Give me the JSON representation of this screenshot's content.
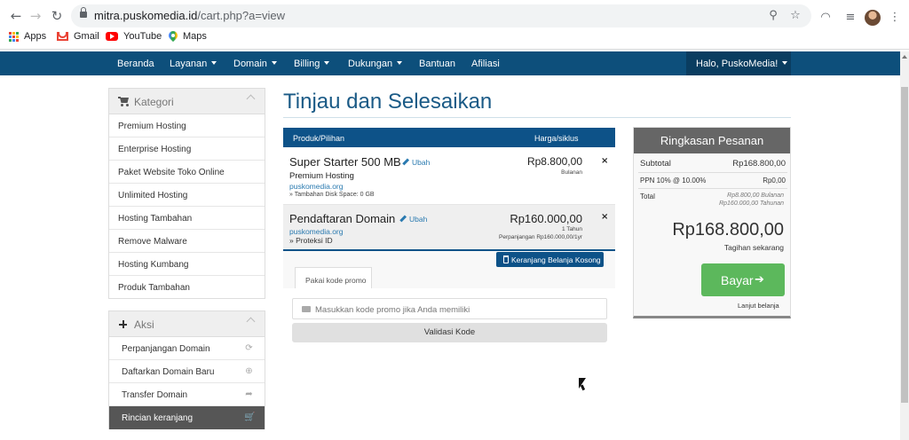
{
  "browser": {
    "url_host": "mitra.puskomedia.id",
    "url_path": "/cart.php?a=view",
    "back_icon": "arrow-left-icon",
    "forward_icon": "arrow-right-icon",
    "reload_icon": "reload-icon",
    "bookmarks": [
      {
        "label": "Apps",
        "icon": "apps-grid-icon"
      },
      {
        "label": "Gmail",
        "icon": "gmail-icon"
      },
      {
        "label": "YouTube",
        "icon": "youtube-icon"
      },
      {
        "label": "Maps",
        "icon": "maps-icon"
      }
    ]
  },
  "navbar": {
    "items": [
      {
        "label": "Beranda",
        "dropdown": false
      },
      {
        "label": "Layanan",
        "dropdown": true
      },
      {
        "label": "Domain",
        "dropdown": true
      },
      {
        "label": "Billing",
        "dropdown": true
      },
      {
        "label": "Dukungan",
        "dropdown": true
      },
      {
        "label": "Bantuan",
        "dropdown": false
      },
      {
        "label": "Afiliasi",
        "dropdown": false
      }
    ],
    "account_label": "Halo, PuskoMedia!",
    "color": "#0d4f7b"
  },
  "sidebar": {
    "kategori": {
      "title": "Kategori",
      "icon": "cart-icon",
      "items": [
        "Premium Hosting",
        "Enterprise Hosting",
        "Paket Website Toko Online",
        "Unlimited Hosting",
        "Hosting Tambahan",
        "Remove Malware",
        "Hosting Kumbang",
        "Produk Tambahan"
      ]
    },
    "aksi": {
      "title": "Aksi",
      "icon": "plus-icon",
      "items": [
        {
          "label": "Perpanjangan Domain",
          "icon": "refresh-icon"
        },
        {
          "label": "Daftarkan Domain Baru",
          "icon": "globe-icon"
        },
        {
          "label": "Transfer Domain",
          "icon": "share-icon"
        },
        {
          "label": "Rincian keranjang",
          "icon": "cart-icon",
          "active": true
        }
      ]
    }
  },
  "main": {
    "title": "Tinjau dan Selesaikan",
    "table_header": {
      "product": "Produk/Pilihan",
      "price": "Harga/siklus"
    },
    "items": [
      {
        "name": "Super Starter 500 MB",
        "edit": "Ubah",
        "group": "Premium Hosting",
        "domain": "puskomedia.org",
        "addon": "» Tambahan Disk Space: 0 GB",
        "price": "Rp8.800,00",
        "cycle": "Bulanan"
      },
      {
        "name": "Pendaftaran Domain",
        "edit": "Ubah",
        "domain": "puskomedia.org",
        "addon": "» Proteksi ID",
        "price": "Rp160.000,00",
        "cycle": "1 Tahun",
        "renewal": "Perpanjangan Rp160.000,00/1yr"
      }
    ],
    "remove_glyph": "×",
    "empty_cart_button": "Keranjang Belanja Kosong",
    "promo_tab": "Pakai kode promo",
    "promo_placeholder": "Masukkan kode promo jika Anda memiliki",
    "validate_button": "Validasi Kode"
  },
  "summary": {
    "title": "Ringkasan Pesanan",
    "subtotal_label": "Subtotal",
    "subtotal_value": "Rp168.800,00",
    "tax_label": "PPN 10% @ 10.00%",
    "tax_value": "Rp0,00",
    "total_label": "Total",
    "total_monthly": "Rp8.800,00 Bulanan",
    "total_yearly": "Rp160.000,00 Tahunan",
    "due_today": "Rp168.800,00",
    "due_today_label": "Tagihan sekarang",
    "pay_button": "Bayar",
    "pay_arrow": "➔",
    "continue_link": "Lanjut belanja",
    "pay_color": "#5cb85c"
  }
}
